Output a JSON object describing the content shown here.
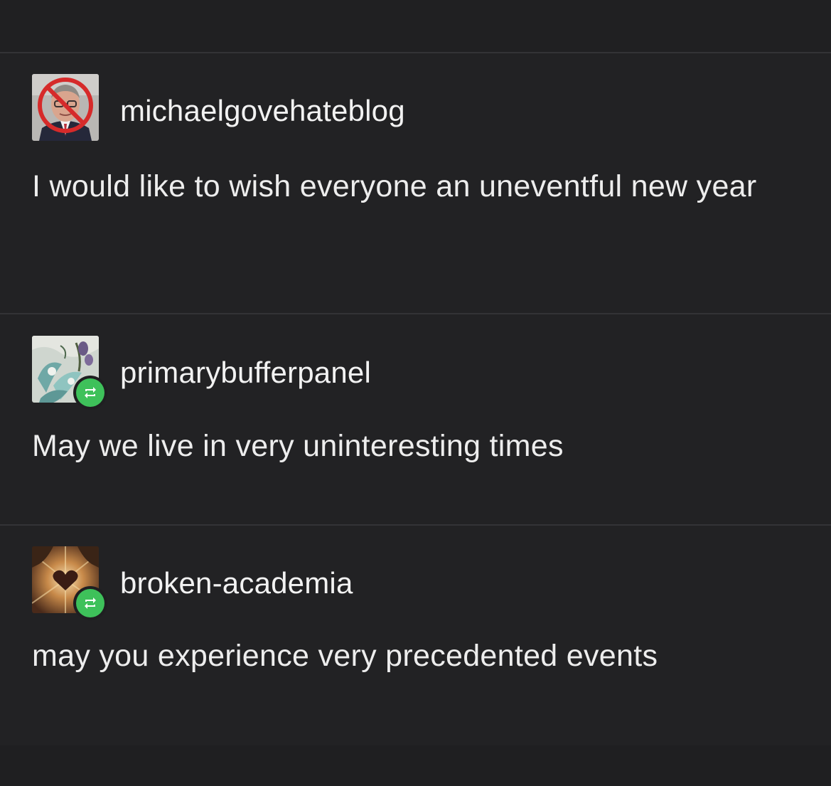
{
  "thread": {
    "posts": [
      {
        "username": "michaelgovehateblog",
        "text": "I would like to wish everyone an uneventful new year",
        "avatar_icon": "crossed-out-portrait-avatar",
        "reblog": false
      },
      {
        "username": "primarybufferpanel",
        "text": "May we live in very uninteresting times",
        "avatar_icon": "floral-pattern-avatar",
        "reblog": true
      },
      {
        "username": "broken-academia",
        "text": "may you experience very precedented events",
        "avatar_icon": "heart-light-burst-avatar",
        "reblog": true
      }
    ]
  },
  "colors": {
    "background": "#222224",
    "divider": "#333336",
    "text": "#ededed",
    "reblog_badge": "#3ec15a",
    "prohibition_red": "#d62a2a"
  }
}
